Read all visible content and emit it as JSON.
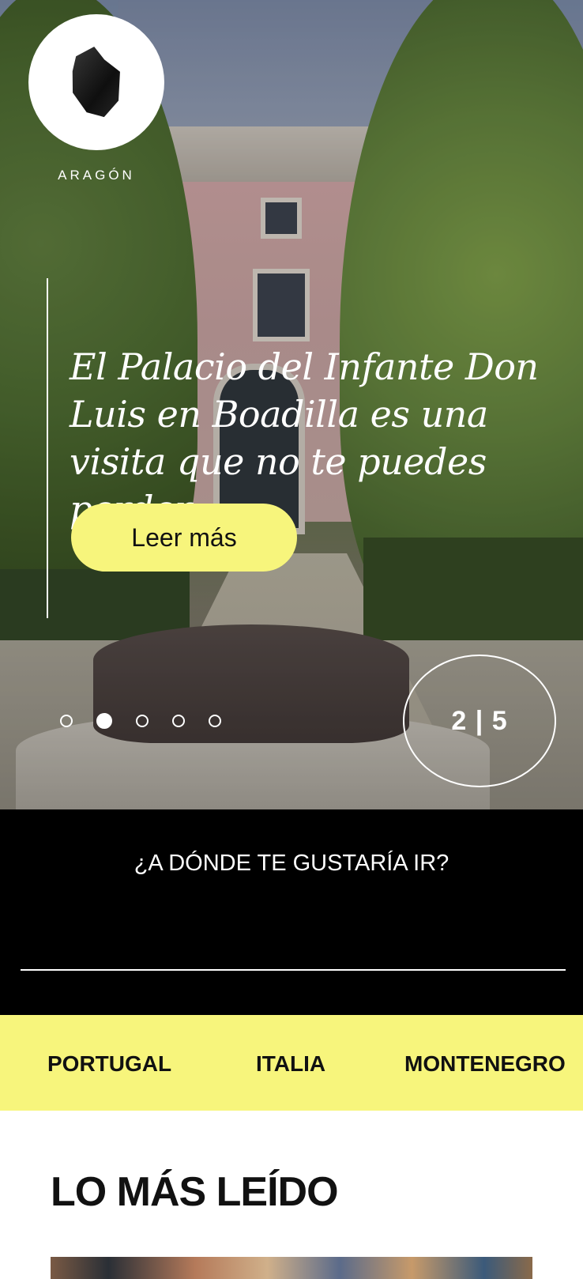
{
  "brand": {
    "label": "ARAGÓN",
    "icon": "rock-icon"
  },
  "hero": {
    "headline": "El Palacio del Infante Don Luis en Boadilla es una visita que no te puedes perder",
    "cta_label": "Leer más",
    "slide_current": 2,
    "slide_total": 5,
    "counter_text": "2 | 5"
  },
  "search": {
    "question": "¿A DÓNDE TE GUSTARÍA IR?",
    "value": "",
    "placeholder": ""
  },
  "countries": [
    "PORTUGAL",
    "ITALIA",
    "MONTENEGRO"
  ],
  "most_read": {
    "title": "LO MÁS LEÍDO"
  },
  "colors": {
    "accent_yellow": "#f7f57c",
    "dark": "#000000"
  }
}
